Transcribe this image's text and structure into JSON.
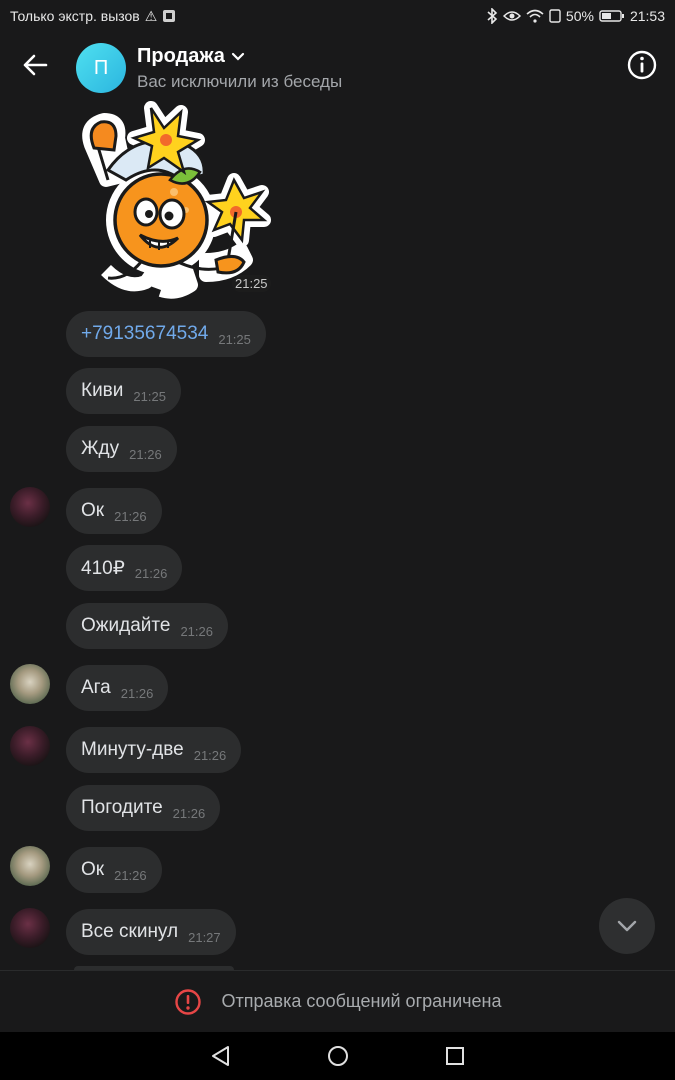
{
  "status_bar": {
    "carrier": "Только экстр. вызов",
    "battery": "50%",
    "time": "21:53"
  },
  "header": {
    "avatar_letter": "П",
    "title": "Продажа",
    "subtitle": "Вас исключили из беседы"
  },
  "sticker": {
    "time": "21:25"
  },
  "messages": [
    {
      "text": "+79135674534",
      "time": "21:25"
    },
    {
      "text": "Киви",
      "time": "21:25"
    },
    {
      "text": "Жду",
      "time": "21:26"
    },
    {
      "text": "Ок",
      "time": "21:26"
    },
    {
      "text": "410₽",
      "time": "21:26"
    },
    {
      "text": "Ожидайте",
      "time": "21:26"
    },
    {
      "text": "Ага",
      "time": "21:26"
    },
    {
      "text": "Минуту-две",
      "time": "21:26"
    },
    {
      "text": "Погодите",
      "time": "21:26"
    },
    {
      "text": "Ок",
      "time": "21:26"
    },
    {
      "text": "Все скинул",
      "time": "21:27"
    }
  ],
  "restricted": {
    "text": "Отправка сообщений ограничена"
  },
  "colors": {
    "background": "#19191a",
    "bubble": "#2c2d2e",
    "link": "#71aaeb",
    "warning": "#e64646"
  }
}
